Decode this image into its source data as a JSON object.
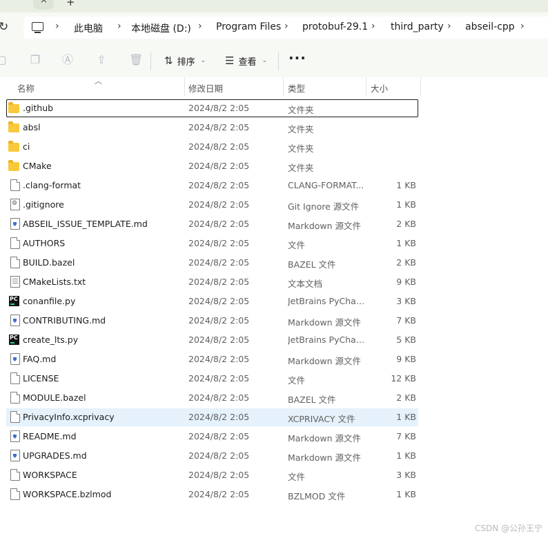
{
  "window": {
    "tab_close_glyph": "×",
    "new_tab_glyph": "+"
  },
  "address": {
    "refresh_glyph": "↻",
    "crumbs": [
      "此电脑",
      "本地磁盘 (D:)",
      "Program Files",
      "protobuf-29.1",
      "third_party",
      "abseil-cpp"
    ],
    "separator": "›"
  },
  "toolbar": {
    "sort_label": "排序",
    "view_label": "查看",
    "more_label": "···",
    "chevron": "⌄"
  },
  "columns": {
    "name": "名称",
    "modified": "修改日期",
    "type": "类型",
    "size": "大小"
  },
  "files": [
    {
      "name": ".github",
      "date": "2024/8/2 2:05",
      "type": "文件夹",
      "size": "",
      "icon": "folder-icon"
    },
    {
      "name": "absl",
      "date": "2024/8/2 2:05",
      "type": "文件夹",
      "size": "",
      "icon": "folder-icon"
    },
    {
      "name": "ci",
      "date": "2024/8/2 2:05",
      "type": "文件夹",
      "size": "",
      "icon": "folder-icon"
    },
    {
      "name": "CMake",
      "date": "2024/8/2 2:05",
      "type": "文件夹",
      "size": "",
      "icon": "folder-icon"
    },
    {
      "name": ".clang-format",
      "date": "2024/8/2 2:05",
      "type": "CLANG-FORMAT...",
      "size": "1 KB",
      "icon": "file-icon"
    },
    {
      "name": ".gitignore",
      "date": "2024/8/2 2:05",
      "type": "Git Ignore 源文件",
      "size": "1 KB",
      "icon": "gear-file-icon"
    },
    {
      "name": "ABSEIL_ISSUE_TEMPLATE.md",
      "date": "2024/8/2 2:05",
      "type": "Markdown 源文件",
      "size": "2 KB",
      "icon": "markdown-file-icon"
    },
    {
      "name": "AUTHORS",
      "date": "2024/8/2 2:05",
      "type": "文件",
      "size": "1 KB",
      "icon": "file-icon"
    },
    {
      "name": "BUILD.bazel",
      "date": "2024/8/2 2:05",
      "type": "BAZEL 文件",
      "size": "2 KB",
      "icon": "file-icon"
    },
    {
      "name": "CMakeLists.txt",
      "date": "2024/8/2 2:05",
      "type": "文本文档",
      "size": "9 KB",
      "icon": "text-file-icon"
    },
    {
      "name": "conanfile.py",
      "date": "2024/8/2 2:05",
      "type": "JetBrains PyChar...",
      "size": "3 KB",
      "icon": "pycharm-file-icon"
    },
    {
      "name": "CONTRIBUTING.md",
      "date": "2024/8/2 2:05",
      "type": "Markdown 源文件",
      "size": "7 KB",
      "icon": "markdown-file-icon"
    },
    {
      "name": "create_lts.py",
      "date": "2024/8/2 2:05",
      "type": "JetBrains PyChar...",
      "size": "5 KB",
      "icon": "pycharm-file-icon"
    },
    {
      "name": "FAQ.md",
      "date": "2024/8/2 2:05",
      "type": "Markdown 源文件",
      "size": "9 KB",
      "icon": "markdown-file-icon"
    },
    {
      "name": "LICENSE",
      "date": "2024/8/2 2:05",
      "type": "文件",
      "size": "12 KB",
      "icon": "file-icon"
    },
    {
      "name": "MODULE.bazel",
      "date": "2024/8/2 2:05",
      "type": "BAZEL 文件",
      "size": "2 KB",
      "icon": "file-icon"
    },
    {
      "name": "PrivacyInfo.xcprivacy",
      "date": "2024/8/2 2:05",
      "type": "XCPRIVACY 文件",
      "size": "1 KB",
      "icon": "file-icon"
    },
    {
      "name": "README.md",
      "date": "2024/8/2 2:05",
      "type": "Markdown 源文件",
      "size": "7 KB",
      "icon": "markdown-file-icon"
    },
    {
      "name": "UPGRADES.md",
      "date": "2024/8/2 2:05",
      "type": "Markdown 源文件",
      "size": "1 KB",
      "icon": "markdown-file-icon"
    },
    {
      "name": "WORKSPACE",
      "date": "2024/8/2 2:05",
      "type": "文件",
      "size": "3 KB",
      "icon": "file-icon"
    },
    {
      "name": "WORKSPACE.bzlmod",
      "date": "2024/8/2 2:05",
      "type": "BZLMOD 文件",
      "size": "1 KB",
      "icon": "file-icon"
    }
  ],
  "state": {
    "focused_row": ".github",
    "hovered_row": "PrivacyInfo.xcprivacy"
  },
  "watermark": "CSDN @公孙王宁",
  "colors": {
    "folder": "#f9c93b",
    "hover": "#e5f1fb",
    "markdown_accent": "#3d6fd1",
    "pycharm_accent": "#21d789"
  }
}
